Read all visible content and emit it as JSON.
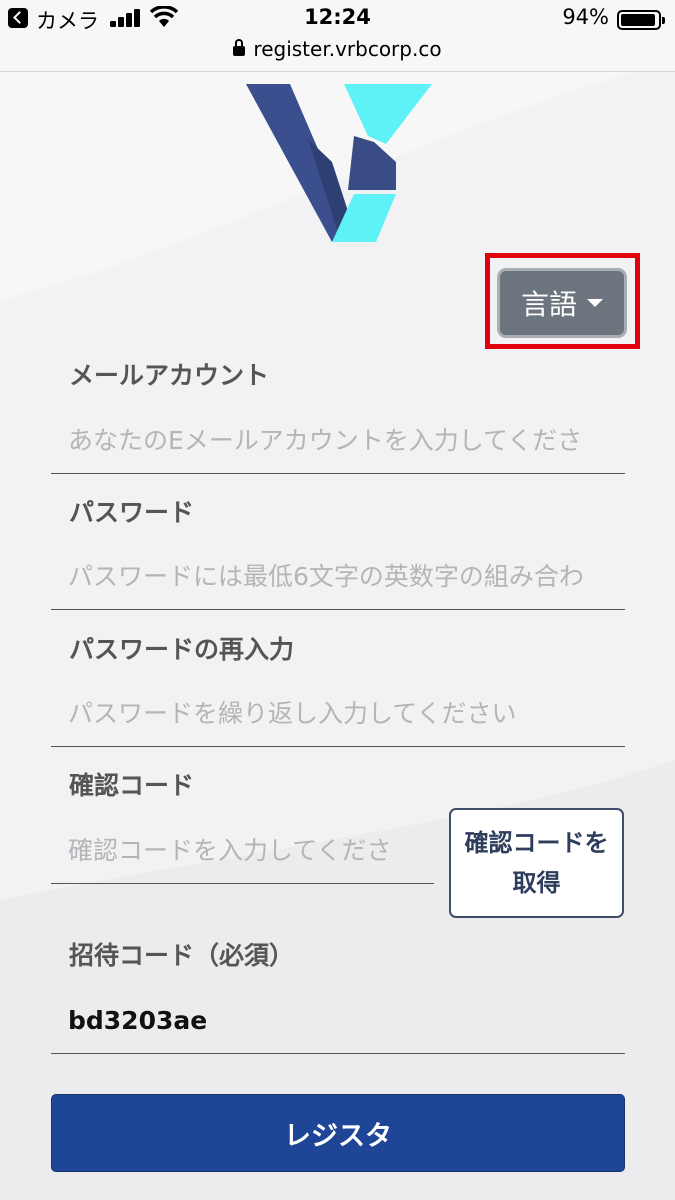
{
  "status_bar": {
    "back_app": "カメラ",
    "time": "12:24",
    "battery": "94%"
  },
  "url_bar": {
    "url": "register.vrbcorp.co"
  },
  "logo": {
    "colors": {
      "dark": "#3b4f8f",
      "light": "#5ef2f7"
    }
  },
  "language_button": {
    "label": "言語"
  },
  "form": {
    "email": {
      "label": "メールアカウント",
      "placeholder": "あなたのEメールアカウントを入力してくださ",
      "value": ""
    },
    "password": {
      "label": "パスワード",
      "placeholder": "パスワードには最低6文字の英数字の組み合わ",
      "value": ""
    },
    "password_confirm": {
      "label": "パスワードの再入力",
      "placeholder": "パスワードを繰り返し入力してください",
      "value": ""
    },
    "verification_code": {
      "label": "確認コード",
      "placeholder": "確認コードを入力してくださ",
      "value": "",
      "get_code_button": "確認コードを取得"
    },
    "invite_code": {
      "label": "招待コード（必須）",
      "value": "bd3203ae"
    },
    "register_button": "レジスタ"
  },
  "colors": {
    "primary": "#1f4597",
    "language_button": "#6c757d",
    "highlight": "#e3000e"
  }
}
